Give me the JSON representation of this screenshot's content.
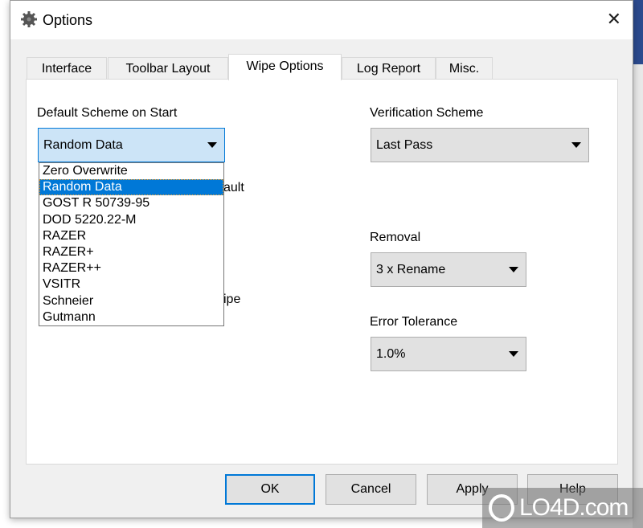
{
  "window": {
    "title": "Options",
    "close": "✕"
  },
  "tabs": [
    {
      "label": "Interface"
    },
    {
      "label": "Toolbar Layout"
    },
    {
      "label": "Wipe Options",
      "active": true
    },
    {
      "label": "Log Report"
    },
    {
      "label": "Misc."
    }
  ],
  "wipe": {
    "default_scheme_label": "Default Scheme on Start",
    "default_scheme_value": "Random Data",
    "default_scheme_options": [
      "Zero Overwrite",
      "Random Data",
      "GOST R 50739-95",
      "DOD 5220.22-M",
      "RAZER",
      "RAZER+",
      "RAZER++",
      "VSITR",
      "Schneier",
      "Gutmann"
    ],
    "hidden_text_1": "ault",
    "hidden_text_2": "ipe",
    "verification_label": "Verification Scheme",
    "verification_value": "Last Pass",
    "removal_label": "Removal",
    "removal_value": "3 x Rename",
    "error_label": "Error Tolerance",
    "error_value": "1.0%"
  },
  "buttons": {
    "ok": "OK",
    "cancel": "Cancel",
    "apply": "Apply",
    "help": "Help"
  },
  "watermark": "LO4D.com",
  "colors": {
    "accent": "#0078d7",
    "selection": "#cce4f7"
  }
}
